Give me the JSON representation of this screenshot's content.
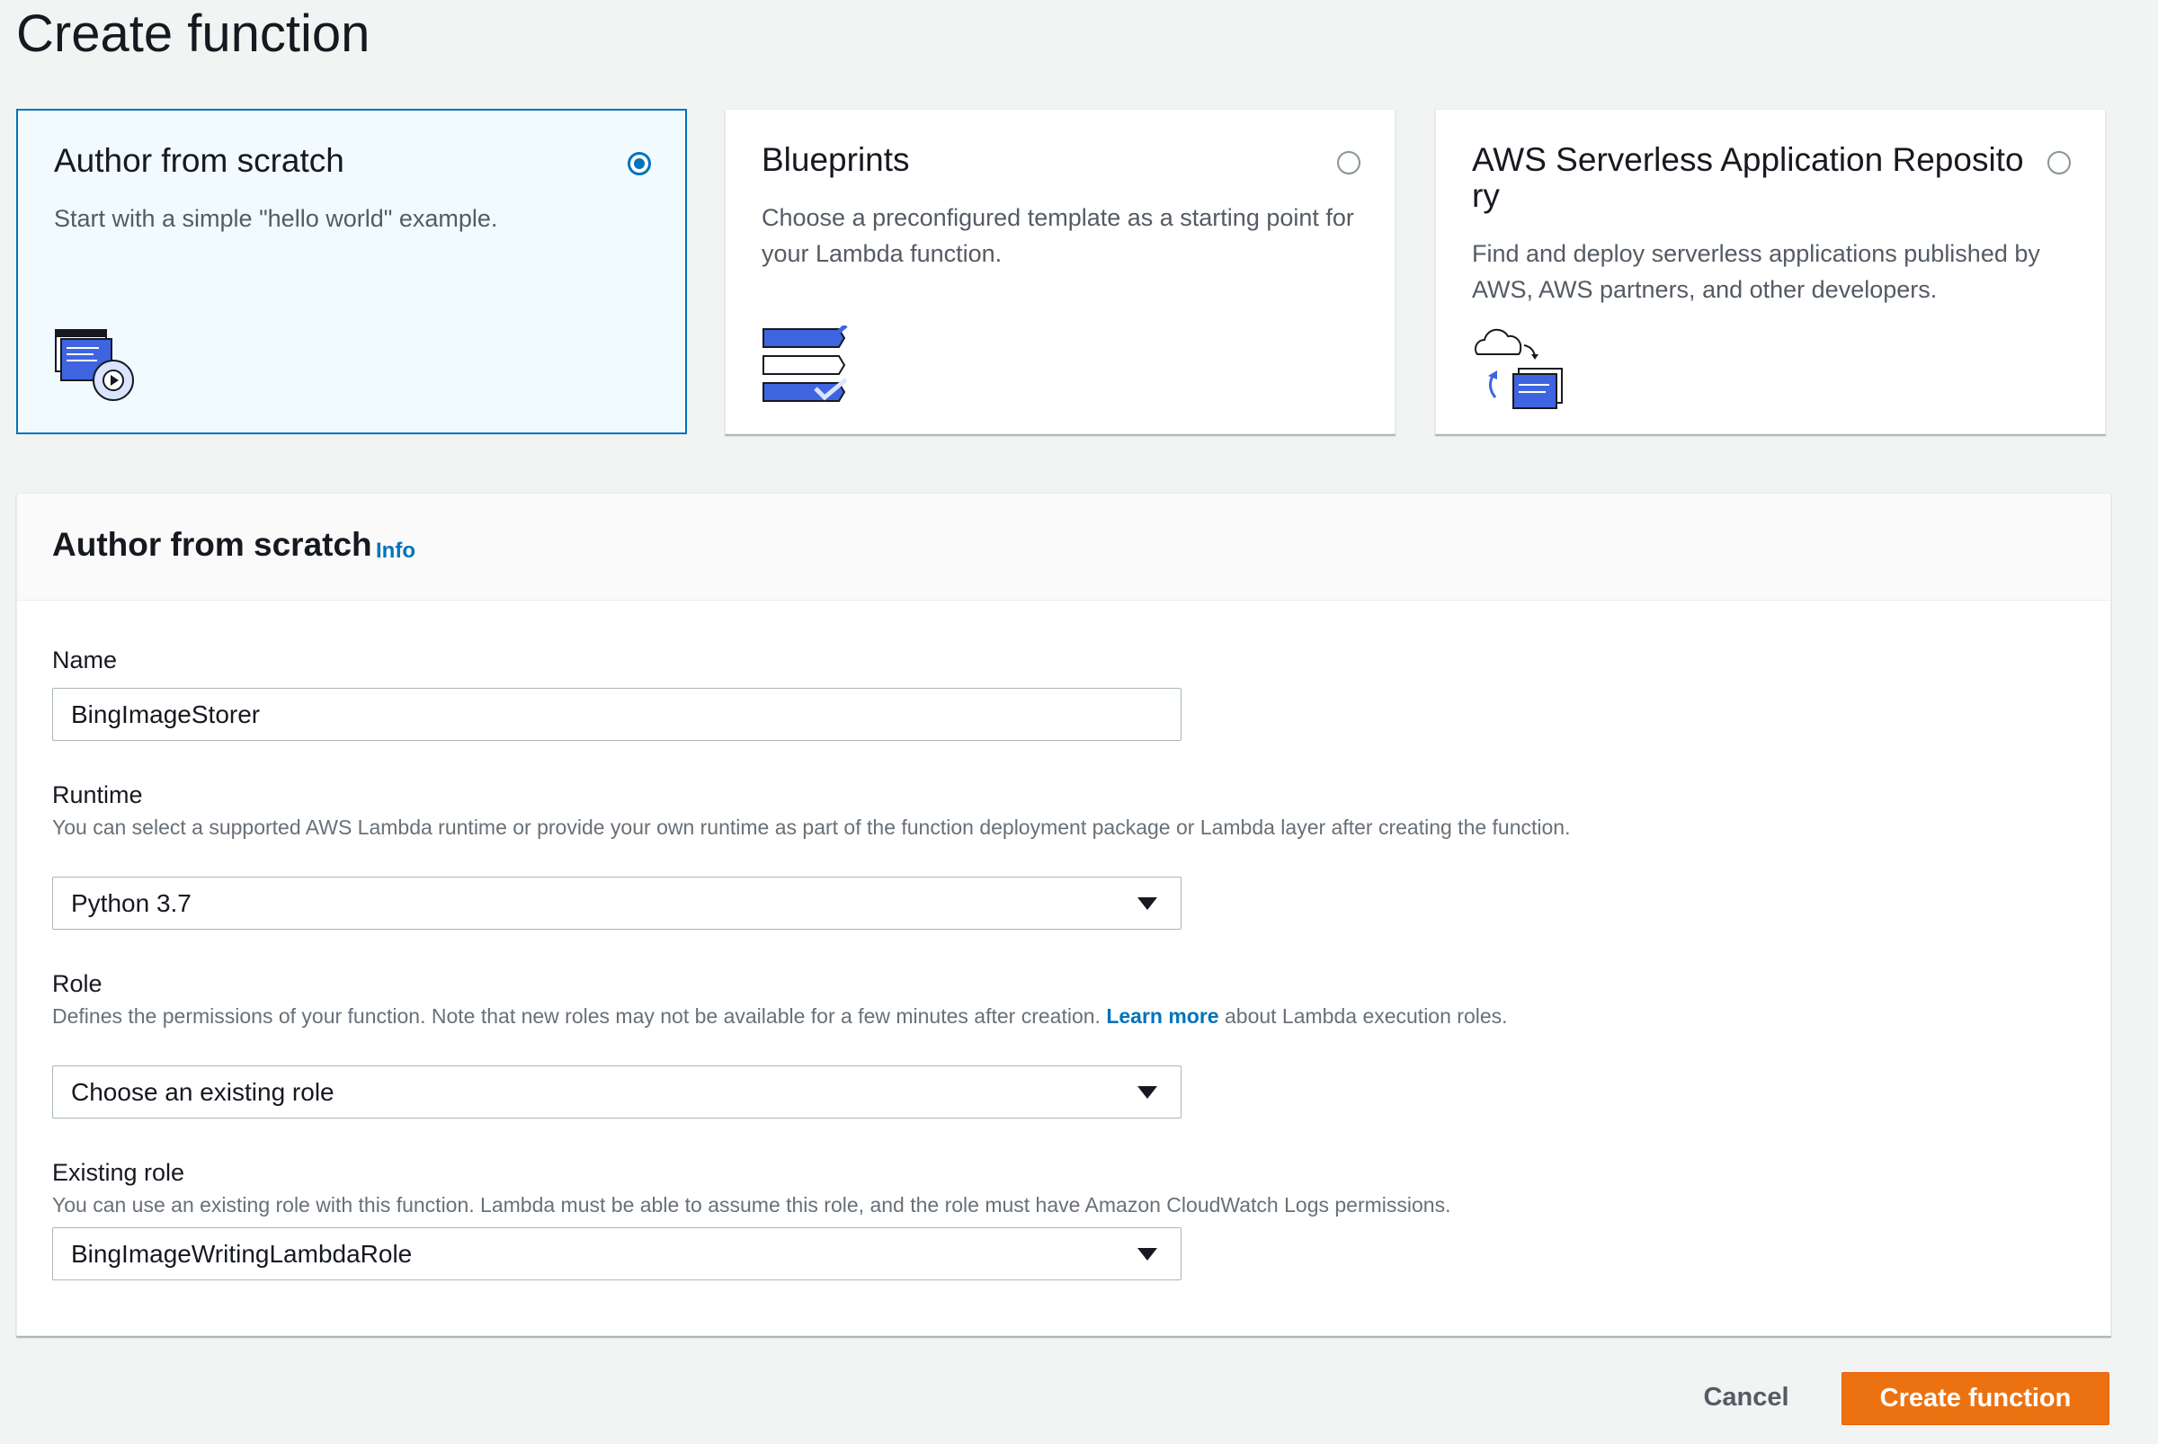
{
  "page": {
    "title": "Create function"
  },
  "options": [
    {
      "title": "Author from scratch",
      "description": "Start with a simple \"hello world\" example.",
      "selected": true,
      "icon": "code-gear-icon"
    },
    {
      "title": "Blueprints",
      "description": "Choose a preconfigured template as a starting point for your Lambda function.",
      "selected": false,
      "icon": "checklist-icon"
    },
    {
      "title": "AWS Serverless Application Reposito ry",
      "description": "Find and deploy serverless applications published by AWS, AWS partners, and other developers.",
      "selected": false,
      "icon": "cloud-repository-icon"
    }
  ],
  "panel": {
    "title": "Author from scratch",
    "info_label": "Info",
    "name": {
      "label": "Name",
      "value": "BingImageStorer"
    },
    "runtime": {
      "label": "Runtime",
      "description": "You can select a supported AWS Lambda runtime or provide your own runtime as part of the function deployment package or Lambda layer after creating the function.",
      "value": "Python 3.7"
    },
    "role": {
      "label": "Role",
      "description_before": "Defines the permissions of your function. Note that new roles may not be available for a few minutes after creation.",
      "link": "Learn more",
      "description_after": "about Lambda execution roles.",
      "value": "Choose an existing role"
    },
    "existing_role": {
      "label": "Existing role",
      "description": "You can use an existing role with this function. Lambda must be able to assume this role, and the role must have Amazon CloudWatch Logs permissions.",
      "value": "BingImageWritingLambdaRole"
    }
  },
  "footer": {
    "cancel_label": "Cancel",
    "create_label": "Create function"
  },
  "colors": {
    "accent": "#0073bb",
    "primary_button": "#ec7211",
    "icon_blue": "#3f64e0"
  }
}
